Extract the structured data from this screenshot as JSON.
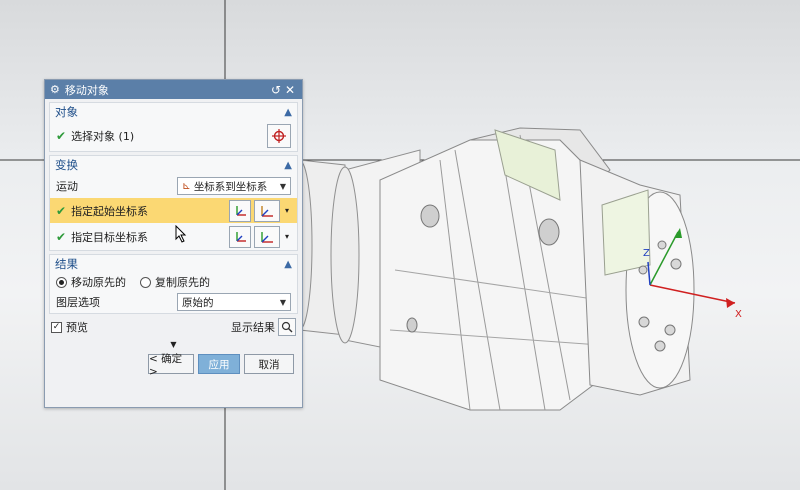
{
  "dialog": {
    "title": "移动对象",
    "reset_icon": "reset-icon",
    "close_icon": "close-icon",
    "sections": {
      "object": {
        "title": "对象",
        "select_label": "选择对象 (1)"
      },
      "transform": {
        "title": "变换",
        "motion_label": "运动",
        "motion_value": "坐标系到坐标系",
        "start_csys_label": "指定起始坐标系",
        "target_csys_label": "指定目标坐标系"
      },
      "result": {
        "title": "结果",
        "move_original": "移动原先的",
        "copy_original": "复制原先的",
        "layer_label": "图层选项",
        "layer_value": "原始的"
      }
    },
    "preview_label": "预览",
    "show_result_label": "显示结果",
    "ok_label": "< 确定 >",
    "apply_label": "应用",
    "cancel_label": "取消"
  },
  "viewport": {
    "axis_labels": {
      "x": "X",
      "z": "Z"
    }
  },
  "colors": {
    "title_bar": "#5b7fa8",
    "highlight": "#fbd873",
    "check": "#2e9a3a",
    "section_title": "#1f4f8a"
  }
}
